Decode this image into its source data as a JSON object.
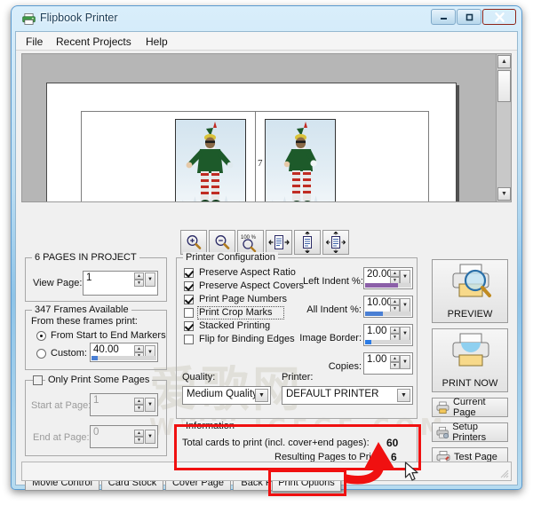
{
  "window": {
    "title": "Flipbook Printer",
    "icon": "printer-icon",
    "minimize_label": "–",
    "maximize_label": "□",
    "close_label": "✕"
  },
  "menu": {
    "items": [
      {
        "label": "File"
      },
      {
        "label": "Recent Projects"
      },
      {
        "label": "Help"
      }
    ]
  },
  "preview": {
    "page_number": "7",
    "scroll_up": "▲",
    "scroll_down": "▼"
  },
  "zoom_toolbar": {
    "buttons": [
      {
        "name": "zoom-in-icon",
        "label": ""
      },
      {
        "name": "zoom-out-icon",
        "label": ""
      },
      {
        "name": "zoom-100-percent-icon",
        "label": "100 %"
      },
      {
        "name": "fit-width-icon",
        "label": ""
      },
      {
        "name": "fit-height-icon",
        "label": ""
      },
      {
        "name": "fit-page-icon",
        "label": ""
      }
    ]
  },
  "pages_group": {
    "title": "6 PAGES IN PROJECT",
    "view_page_label": "View Page:",
    "view_page_value": "1"
  },
  "frames_group": {
    "title": "347 Frames Available",
    "subtitle": "From these frames print:",
    "radio_start_end": "From Start to End Markers",
    "radio_custom": "Custom:",
    "custom_value": "40.00",
    "selected": "start_end"
  },
  "some_pages_group": {
    "title": "Only Print Some Pages",
    "checked": false,
    "start_label": "Start at Page:",
    "start_value": "1",
    "end_label": "End at Page:",
    "end_value": "0"
  },
  "printer_config": {
    "title": "Printer Configuration",
    "checkboxes": [
      {
        "label": "Preserve Aspect Ratio",
        "checked": true
      },
      {
        "label": "Preserve Aspect Covers",
        "checked": true
      },
      {
        "label": "Print Page Numbers",
        "checked": true
      },
      {
        "label": "Print Crop Marks",
        "checked": false
      },
      {
        "label": "Stacked Printing",
        "checked": true
      },
      {
        "label": "Flip for Binding Edges",
        "checked": false
      }
    ],
    "fields": [
      {
        "label": "Left Indent %:",
        "value": "20.00",
        "bar_percent": 72,
        "bar_color": "#8B5FA8"
      },
      {
        "label": "All Indent %:",
        "value": "10.00",
        "bar_percent": 38,
        "bar_color": "#4A7FD4"
      },
      {
        "label": "Image Border:",
        "value": "1.00",
        "bar_percent": 14,
        "bar_color": "#2B7BE4"
      },
      {
        "label": "Copies:",
        "value": "1.00",
        "bar_percent": 0,
        "bar_color": "#2B7BE4"
      }
    ],
    "quality_label": "Quality:",
    "quality_value": "Medium Quality",
    "printer_label": "Printer:",
    "printer_value": "DEFAULT PRINTER"
  },
  "information": {
    "title": "Information",
    "rows": [
      {
        "label": "Total cards to print (incl. cover+end pages):",
        "value": "60"
      },
      {
        "label": "Resulting Pages to Print:",
        "value": "6"
      }
    ]
  },
  "actions": {
    "preview_label": "PREVIEW",
    "print_now_label": "PRINT NOW",
    "current_page_label": "Current Page",
    "setup_printers_label": "Setup Printers",
    "test_page_label": "Test Page"
  },
  "tabs": {
    "items": [
      {
        "label": "Movie Control",
        "selected": false
      },
      {
        "label": "Card Stock",
        "selected": false
      },
      {
        "label": "Cover Page",
        "selected": false
      },
      {
        "label": "Back Page",
        "selected": false
      },
      {
        "label": "Print Options",
        "selected": true
      }
    ]
  },
  "annotations": {
    "highlight_color": "#f01010",
    "highlighted_regions": [
      "information-group",
      "tab-print-options"
    ]
  },
  "colors": {
    "title_gradient_start": "#d9eefb",
    "title_gradient_end": "#8fc4e8",
    "window_border": "#5b9bd0",
    "client_background": "#f0f0f0",
    "close_button": "#bd3a2c",
    "annotation_red": "#f01010",
    "left_indent_bar": "#8B5FA8",
    "all_indent_bar": "#4A7FD4"
  },
  "watermark": {
    "line1": "爱歌网",
    "line2": "WWW.IGEGE.COM"
  }
}
